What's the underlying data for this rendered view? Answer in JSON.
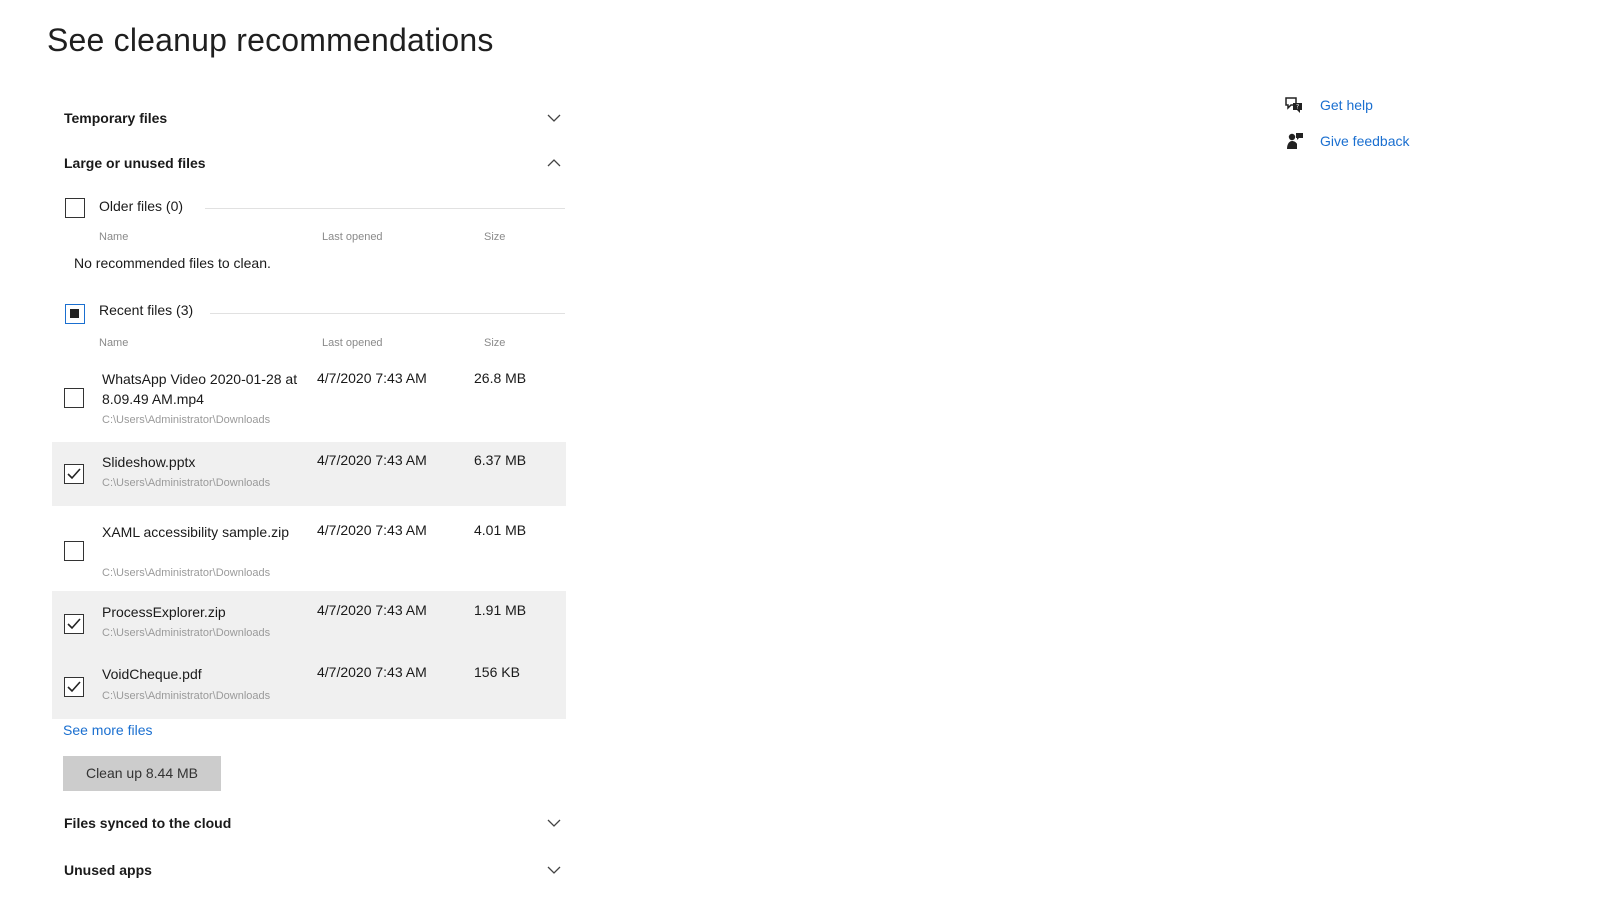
{
  "page": {
    "title": "See cleanup recommendations"
  },
  "sections": {
    "temporary": {
      "label": "Temporary files",
      "state": "collapsed"
    },
    "large_unused": {
      "label": "Large or unused files",
      "state": "expanded"
    },
    "cloud": {
      "label": "Files synced to the cloud",
      "state": "collapsed"
    },
    "unused_apps": {
      "label": "Unused apps",
      "state": "collapsed"
    }
  },
  "older_files": {
    "label": "Older files (0)",
    "checked": false,
    "columns": {
      "name": "Name",
      "last_opened": "Last opened",
      "size": "Size"
    },
    "empty_message": "No recommended files to clean."
  },
  "recent_files": {
    "label": "Recent files (3)",
    "state": "partial",
    "columns": {
      "name": "Name",
      "last_opened": "Last opened",
      "size": "Size"
    },
    "files": [
      {
        "name": "WhatsApp Video 2020-01-28 at 8.09.49 AM.mp4",
        "path": "C:\\Users\\Administrator\\Downloads",
        "last_opened": "4/7/2020 7:43 AM",
        "size": "26.8 MB",
        "checked": false
      },
      {
        "name": "Slideshow.pptx",
        "path": "C:\\Users\\Administrator\\Downloads",
        "last_opened": "4/7/2020 7:43 AM",
        "size": "6.37 MB",
        "checked": true
      },
      {
        "name": "XAML accessibility sample.zip",
        "path": "C:\\Users\\Administrator\\Downloads",
        "last_opened": "4/7/2020 7:43 AM",
        "size": "4.01 MB",
        "checked": false
      },
      {
        "name": "ProcessExplorer.zip",
        "path": "C:\\Users\\Administrator\\Downloads",
        "last_opened": "4/7/2020 7:43 AM",
        "size": "1.91 MB",
        "checked": true
      },
      {
        "name": "VoidCheque.pdf",
        "path": "C:\\Users\\Administrator\\Downloads",
        "last_opened": "4/7/2020 7:43 AM",
        "size": "156 KB",
        "checked": true
      }
    ]
  },
  "see_more": "See more files",
  "cleanup_button": "Clean up 8.44 MB",
  "help": {
    "get_help": {
      "label": "Get help",
      "icon": "help-chat-icon"
    },
    "give_feedback": {
      "label": "Give feedback",
      "icon": "feedback-icon"
    }
  },
  "colors": {
    "link": "#1a6fd0",
    "selected_row": "#f0f0f0",
    "button": "#cccccc"
  }
}
